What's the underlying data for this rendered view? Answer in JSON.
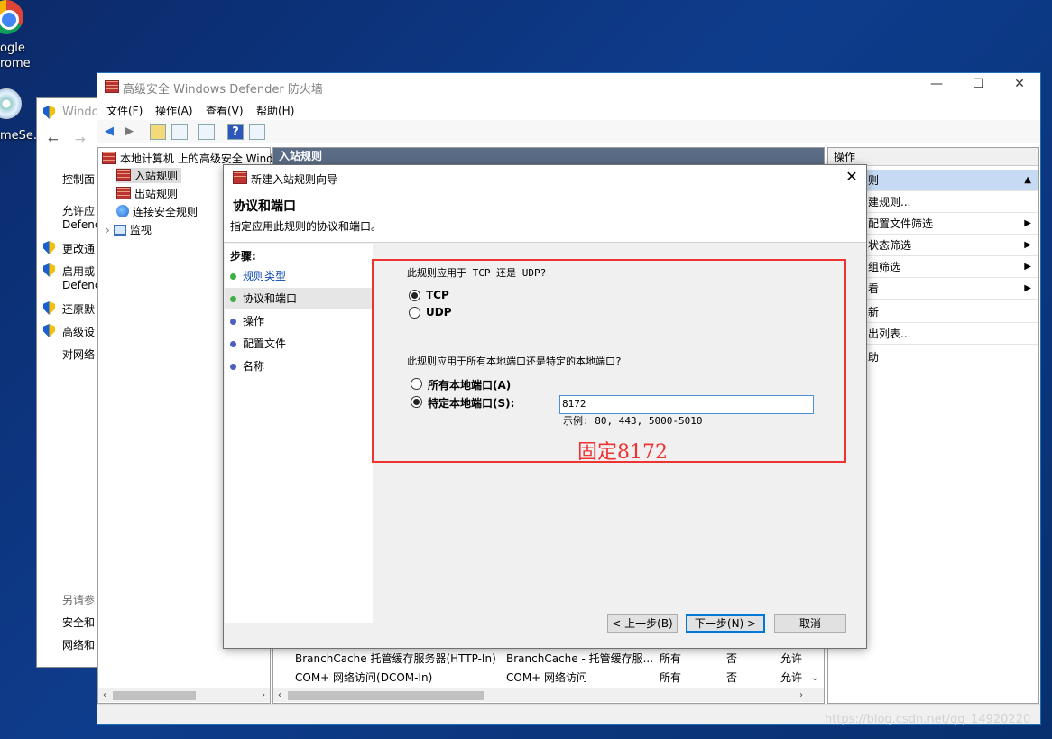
{
  "desktop": {
    "chrome_label_1": "ogle",
    "chrome_label_2": "rome",
    "other_label": "meSe..."
  },
  "back_window": {
    "title": "Windo",
    "links": [
      "控制面",
      "允许应",
      "Defenc",
      "更改通",
      "启用或",
      "Defenc",
      "还原默",
      "高级设",
      "对网络"
    ],
    "see_also": "另请参",
    "see_also_links": [
      "安全和",
      "网络和"
    ]
  },
  "main_window": {
    "title": "高级安全 Windows Defender 防火墙",
    "minimize": "—",
    "maximize": "☐",
    "close": "✕",
    "menu": [
      "文件(F)",
      "操作(A)",
      "查看(V)",
      "帮助(H)"
    ],
    "tree": {
      "root": "本地计算机 上的高级安全 Wind",
      "items": [
        "入站规则",
        "出站规则",
        "连接安全规则",
        "监视"
      ]
    },
    "center_header": "入站规则",
    "list_rows": [
      {
        "name": "BranchCache 托管缓存服务器(HTTP-In)",
        "group": "BranchCache - 托管缓存服...",
        "profile": "所有",
        "enabled": "否",
        "action": "允许"
      },
      {
        "name": "COM+ 网络访问(DCOM-In)",
        "group": "COM+ 网络访问",
        "profile": "所有",
        "enabled": "否",
        "action": "允许"
      }
    ],
    "actions": {
      "header": "操作",
      "items": [
        {
          "label": "则",
          "arrow": "▲"
        },
        {
          "label": "建规则...",
          "arrow": ""
        },
        {
          "label": "配置文件筛选",
          "arrow": "▶"
        },
        {
          "label": "状态筛选",
          "arrow": "▶"
        },
        {
          "label": "组筛选",
          "arrow": "▶"
        },
        {
          "label": "看",
          "arrow": "▶"
        },
        {
          "label": "新",
          "arrow": ""
        },
        {
          "label": "出列表...",
          "arrow": ""
        },
        {
          "label": "助",
          "arrow": ""
        }
      ]
    }
  },
  "wizard": {
    "title": "新建入站规则向导",
    "heading": "协议和端口",
    "subheading": "指定应用此规则的协议和端口。",
    "steps_title": "步骤:",
    "steps": [
      {
        "label": "规则类型",
        "color": "#3cb043",
        "link": true
      },
      {
        "label": "协议和端口",
        "color": "#3cb043",
        "link": false
      },
      {
        "label": "操作",
        "color": "#4a5fc1",
        "link": false
      },
      {
        "label": "配置文件",
        "color": "#4a5fc1",
        "link": false
      },
      {
        "label": "名称",
        "color": "#4a5fc1",
        "link": false
      }
    ],
    "q_protocol": "此规则应用于 TCP 还是 UDP?",
    "tcp_label": "TCP",
    "udp_label": "UDP",
    "q_ports": "此规则应用于所有本地端口还是特定的本地端口?",
    "all_ports_label": "所有本地端口(A)",
    "specific_ports_label": "特定本地端口(S):",
    "port_value": "8172",
    "example": "示例: 80, 443, 5000-5010",
    "annotation": "固定8172",
    "back_button": "< 上一步(B)",
    "next_button": "下一步(N) >",
    "cancel_button": "取消",
    "close": "✕"
  },
  "watermark": "https://blog.csdn.net/qq_14920220",
  "colors": {
    "accent": "#0078d7",
    "annotation_red": "#e33333",
    "header_bg": "#5a6c86"
  }
}
